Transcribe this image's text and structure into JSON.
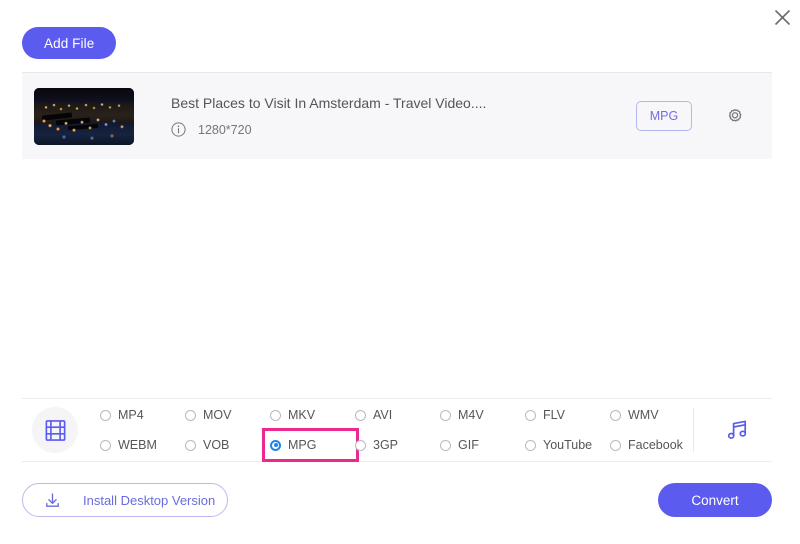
{
  "window": {
    "close_icon": "close-icon"
  },
  "toolbar": {
    "add_file_label": "Add File"
  },
  "file_row": {
    "title": "Best Places to Visit In Amsterdam - Travel Video....",
    "info_icon": "info-icon",
    "resolution": "1280*720",
    "output_format_badge": "MPG",
    "settings_icon": "gear-icon",
    "thumbnail_alt": "amsterdam-night-cityscape"
  },
  "format_bar": {
    "video_icon": "film-strip-icon",
    "audio_icon": "music-note-icon",
    "selected_format": "MPG",
    "formats": [
      {
        "label": "MP4",
        "selected": false
      },
      {
        "label": "MOV",
        "selected": false
      },
      {
        "label": "MKV",
        "selected": false
      },
      {
        "label": "AVI",
        "selected": false
      },
      {
        "label": "M4V",
        "selected": false
      },
      {
        "label": "FLV",
        "selected": false
      },
      {
        "label": "WMV",
        "selected": false
      },
      {
        "label": "WEBM",
        "selected": false
      },
      {
        "label": "VOB",
        "selected": false
      },
      {
        "label": "MPG",
        "selected": true
      },
      {
        "label": "3GP",
        "selected": false
      },
      {
        "label": "GIF",
        "selected": false
      },
      {
        "label": "YouTube",
        "selected": false
      },
      {
        "label": "Facebook",
        "selected": false
      }
    ]
  },
  "footer": {
    "install_label": "Install Desktop Version",
    "install_icon": "download-icon",
    "convert_label": "Convert"
  },
  "colors": {
    "accent": "#5b5bef",
    "accent_light": "#7070e0",
    "highlight": "#ec2891",
    "radio_selected": "#1f86e8",
    "row_bg": "#f7f7f9"
  }
}
